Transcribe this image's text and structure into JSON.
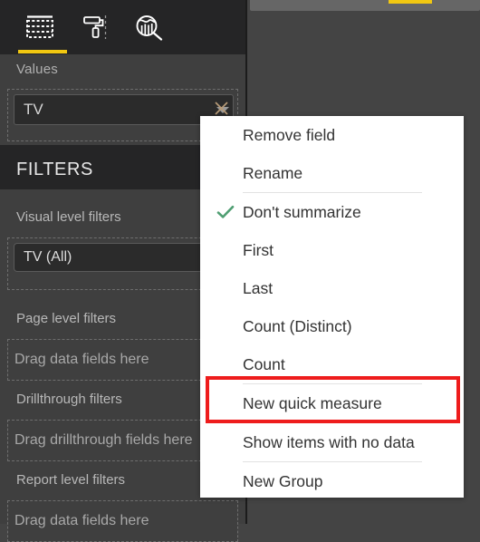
{
  "app": {
    "accent_yellow": "#f2c811",
    "highlight_red": "#ee1c1c",
    "check_green": "#4f9e72",
    "panel_bg": "#3f3f3f",
    "dark_bg": "#252526",
    "menu_bg": "#ffffff"
  },
  "visualizations_pane": {
    "tabs": [
      {
        "name": "fields-icon",
        "label": "Fields",
        "selected": true
      },
      {
        "name": "format-icon",
        "label": "Format",
        "selected": false
      },
      {
        "name": "analytics-icon",
        "label": "Analytics",
        "selected": false
      }
    ],
    "values_section": {
      "label": "Values",
      "field_chip": {
        "label": "TV",
        "caret_icon": "chevron-down-icon",
        "remove_icon": "close-icon"
      }
    }
  },
  "filters_pane": {
    "title": "FILTERS",
    "groups": [
      {
        "label": "Visual level filters",
        "chip": "TV  (All)",
        "placeholder": null
      },
      {
        "label": "Page level filters",
        "chip": null,
        "placeholder": "Drag data fields here"
      },
      {
        "label": "Drillthrough filters",
        "chip": null,
        "placeholder": "Drag drillthrough fields here"
      },
      {
        "label": "Report level filters",
        "chip": null,
        "placeholder": "Drag data fields here"
      }
    ]
  },
  "context_menu": {
    "items": [
      {
        "label": "Remove field",
        "checked": false,
        "sep_after": false
      },
      {
        "label": "Rename",
        "checked": false,
        "sep_after": true
      },
      {
        "label": "Don't summarize",
        "checked": true,
        "sep_after": false
      },
      {
        "label": "First",
        "checked": false,
        "sep_after": false
      },
      {
        "label": "Last",
        "checked": false,
        "sep_after": false
      },
      {
        "label": "Count (Distinct)",
        "checked": false,
        "sep_after": false
      },
      {
        "label": "Count",
        "checked": false,
        "sep_after": true
      },
      {
        "label": "New quick measure",
        "checked": false,
        "sep_after": true
      },
      {
        "label": "Show items with no data",
        "checked": false,
        "sep_after": true
      },
      {
        "label": "New Group",
        "checked": false,
        "sep_after": false
      }
    ],
    "check_icon": "checkmark-icon",
    "highlighted_item": "New quick measure"
  }
}
